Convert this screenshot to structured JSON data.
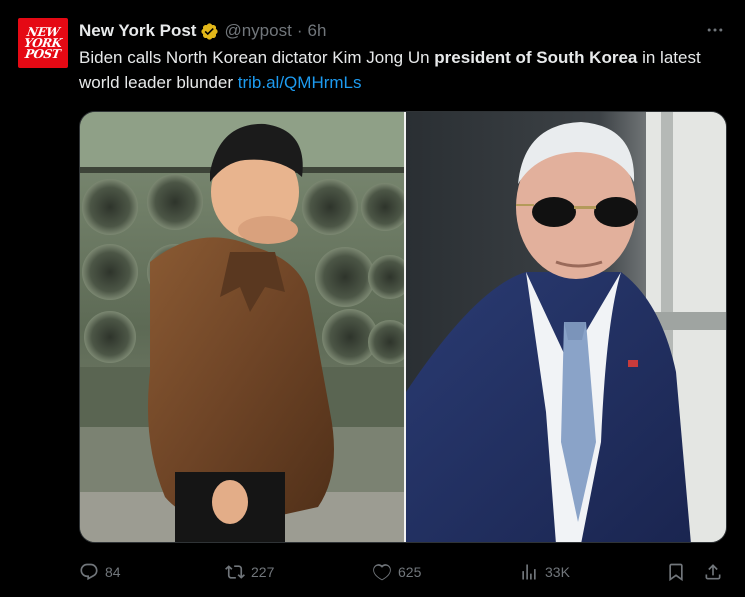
{
  "account": {
    "avatar_lines": [
      "NEW",
      "YORK",
      "POST"
    ],
    "display_name": "New York Post",
    "handle": "@nypost",
    "separator": "·",
    "time": "6h",
    "verified_color": "#e2b719"
  },
  "tweet": {
    "text_before": "Biden calls North Korean dictator Kim Jong Un ",
    "text_bold": "president of South Korea",
    "text_after": " in latest world leader blunder ",
    "link": "trib.al/QMHrmLs"
  },
  "media": {
    "left_photo": "kim-jong-un-photo",
    "right_photo": "joe-biden-photo"
  },
  "actions": {
    "replies": "84",
    "reposts": "227",
    "likes": "625",
    "views": "33K"
  },
  "colors": {
    "background": "#000000",
    "text": "#e7e9ea",
    "muted": "#71767b",
    "link": "#1d9bf0",
    "brand_red": "#e50914"
  }
}
